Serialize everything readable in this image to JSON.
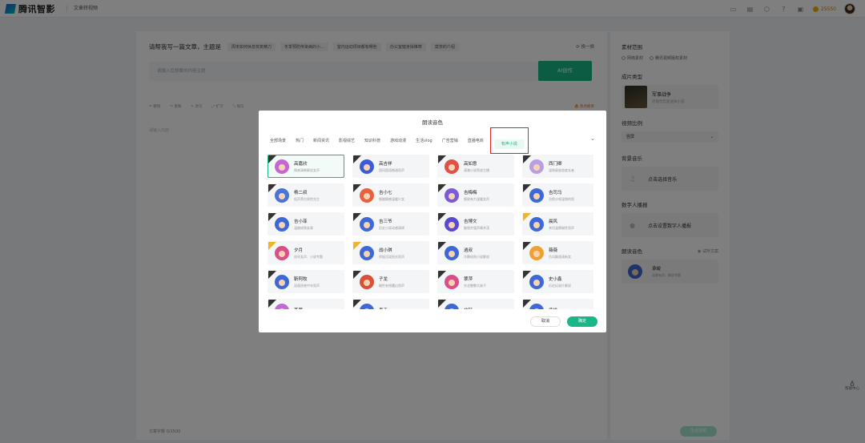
{
  "app": {
    "name": "腾讯智影",
    "breadcrumb": "文章转视频"
  },
  "topbar": {
    "coins": "25550"
  },
  "editor": {
    "prompt_title": "请帮我写一篇文章，主题是",
    "chips": [
      "周末如何休息恢复精力",
      "冬季预防传染病的小...",
      "室内运动项目都有哪些",
      "办公室健身操推荐",
      "莫奈的介绍"
    ],
    "swap": "换一换",
    "input_placeholder": "请输入您想要的内容主题",
    "ai_button": "AI创作",
    "tools": [
      "撤销",
      "重做",
      "改写",
      "扩写",
      "缩写"
    ],
    "hot": "热点榜单",
    "body_placeholder": "请输入内容",
    "word_count": "文章字数 0/1500"
  },
  "right_panel": {
    "source_title": "素材范围",
    "source_opt1": "网络素材",
    "source_opt2": "腾讯视频版权素材",
    "type_title": "成片类型",
    "type_name": "军事战争",
    "type_desc": "近现代历史战争小说",
    "ratio_title": "视频比例",
    "ratio_value": "竖屏",
    "music_title": "背景音乐",
    "music_action": "点击选择音乐",
    "avatar_title": "数字人播报",
    "avatar_action": "点击设置数字人播报",
    "voice_title": "朗读音色",
    "voice_link": "试听文案",
    "voice_name": "承峻",
    "voice_desc": "深厚有声、解说专题"
  },
  "help": "帮助中心",
  "generate_button": "生成视频",
  "modal": {
    "title": "朗读音色",
    "tabs": [
      "全部场景",
      "热门",
      "新闻资讯",
      "影视综艺",
      "知识科普",
      "游戏动漫",
      "生活vlog",
      "广告营销",
      "直播电商",
      "有声小说"
    ],
    "active_tab": 9,
    "voices": [
      {
        "name": "高嘉欣",
        "desc": "情感清晰解说女声",
        "color": "#c466d6",
        "badge": "dark"
      },
      {
        "name": "高吉祥",
        "desc": "国风国语朗诵男声",
        "color": "#3c5bd6",
        "badge": "dark"
      },
      {
        "name": "高如意",
        "desc": "清澈小说旁述主播",
        "color": "#e05044",
        "badge": "dark"
      },
      {
        "name": "西门卿",
        "desc": "温和豪放态度长者",
        "color": "#b8a0e0",
        "badge": "dark"
      },
      {
        "name": "杨二叔",
        "desc": "低声旁白男性先生",
        "color": "#4a74d8",
        "badge": "dark"
      },
      {
        "name": "吉小七",
        "desc": "细腻情感温暖少女",
        "color": "#e86040",
        "badge": "dark"
      },
      {
        "name": "吉梅梅",
        "desc": "细致有力温暖女声",
        "color": "#7a5cd6",
        "badge": "dark"
      },
      {
        "name": "吉司马",
        "desc": "治愈沙哑温和的男",
        "color": "#3e68d6",
        "badge": "dark"
      },
      {
        "name": "吉小菲",
        "desc": "温婉成熟女青",
        "color": "#3e68d6",
        "badge": "dark"
      },
      {
        "name": "吉三爷",
        "desc": "历史小说动感演绎",
        "color": "#3e68d6",
        "badge": "dark"
      },
      {
        "name": "吉博文",
        "desc": "脑袋京强声情并茂",
        "color": "#5a4ad0",
        "badge": "dark"
      },
      {
        "name": "晨风",
        "desc": "亲切温厚磁性男声",
        "color": "#3e68d6",
        "badge": "gold"
      },
      {
        "name": "夕月",
        "desc": "成年女声、小说专题",
        "color": "#d94f8a",
        "badge": "gold"
      },
      {
        "name": "战小琪",
        "desc": "积极活泼阳光男声",
        "color": "#3e68d6",
        "badge": "gold"
      },
      {
        "name": "逍叔",
        "desc": "冷静成熟小说解说",
        "color": "#3e68d6",
        "badge": "dark"
      },
      {
        "name": "薇薇",
        "desc": "古风飘逸清新女",
        "color": "#f0a030",
        "badge": "dark"
      },
      {
        "name": "靳阿牧",
        "desc": "深邃质感中年男声",
        "color": "#3e68d6",
        "badge": "dark"
      },
      {
        "name": "子龙",
        "desc": "磁性有韧魔幻男声",
        "color": "#d94f3a",
        "badge": "dark"
      },
      {
        "name": "翠萍",
        "desc": "东北憨憨大妹子",
        "color": "#d94f8a",
        "badge": "dark"
      },
      {
        "name": "史小鑫",
        "desc": "历史纪录片解说",
        "color": "#3e68d6",
        "badge": "dark"
      },
      {
        "name": "茶蔻",
        "desc": "",
        "color": "#c466d6",
        "badge": "dark"
      },
      {
        "name": "春天",
        "desc": "",
        "color": "#3e68d6",
        "badge": "dark"
      },
      {
        "name": "北轩",
        "desc": "",
        "color": "#3e68d6",
        "badge": "dark"
      },
      {
        "name": "承峻",
        "desc": "",
        "color": "#3e68d6",
        "badge": "dark"
      }
    ],
    "selected_index": 0,
    "cancel": "取消",
    "confirm": "确定"
  },
  "colors": {
    "accent": "#19b787",
    "highlight_box": "#e02020"
  }
}
